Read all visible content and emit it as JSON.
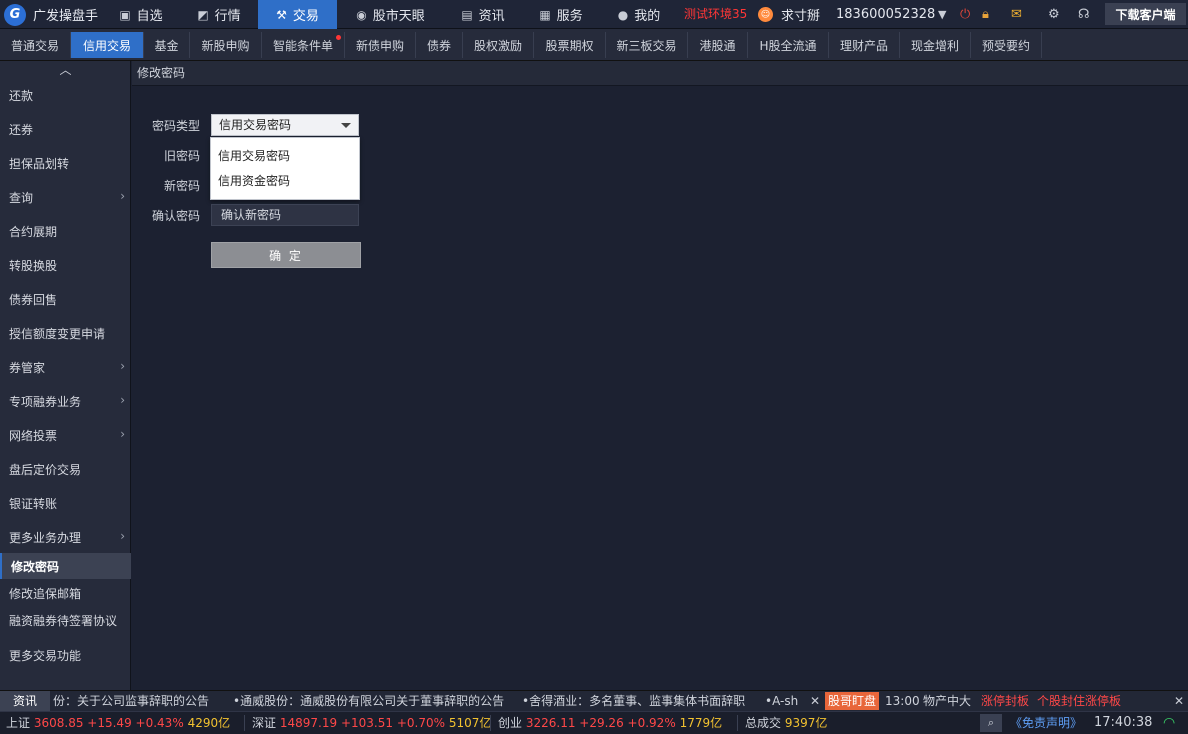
{
  "app": {
    "name": "广发操盘手",
    "logo_letter": "G"
  },
  "topnav": [
    {
      "label": "自选",
      "icon": "star-box-icon"
    },
    {
      "label": "行情",
      "icon": "chart-icon"
    },
    {
      "label": "交易",
      "icon": "gavel-icon",
      "active": true
    },
    {
      "label": "股市天眼",
      "icon": "eye-icon"
    },
    {
      "label": "资讯",
      "icon": "news-icon"
    },
    {
      "label": "服务",
      "icon": "briefcase-icon"
    },
    {
      "label": "我的",
      "icon": "user-icon"
    }
  ],
  "env_label": "测试环境35",
  "user": {
    "name": "求寸掰",
    "phone": "183600052328"
  },
  "download_label": "下载客户端",
  "subtabs": [
    "普通交易",
    "信用交易",
    "基金",
    "新股申购",
    "智能条件单",
    "新债申购",
    "债券",
    "股权激励",
    "股票期权",
    "新三板交易",
    "港股通",
    "H股全流通",
    "理财产品",
    "现金增利",
    "预受要约"
  ],
  "sidebar": {
    "items": [
      "还款",
      "还券",
      "担保品划转",
      "查询",
      "合约展期",
      "转股换股",
      "债券回售",
      "授信额度变更申请",
      "券管家",
      "专项融券业务",
      "网络投票",
      "盘后定价交易",
      "银证转账",
      "更多业务办理",
      "修改密码",
      "修改追保邮箱",
      "融资融券待签署协议",
      "更多交易功能"
    ]
  },
  "main": {
    "breadcrumb": "修改密码",
    "form": {
      "type_label": "密码类型",
      "type_value": "信用交易密码",
      "options": [
        "信用交易密码",
        "信用资金密码"
      ],
      "old_label": "旧密码",
      "new_label": "新密码",
      "confirm_label": "确认密码",
      "confirm_placeholder": "确认新密码",
      "submit": "确 定"
    }
  },
  "ticker": {
    "tab": "资讯",
    "news1": "份：关于公司监事辞职的公告",
    "news2": "•通威股份：通威股份有限公司关于董事辞职的公告",
    "news3": "•舍得酒业：多名董事、监事集体书面辞职",
    "news4": "•A-sh",
    "hot_label": "股哥盯盘",
    "time": "13:00",
    "item1": "物产中大",
    "item2": "涨停封板",
    "item3": "个股封住涨停板"
  },
  "status": {
    "sh": {
      "label": "上证",
      "price": "3608.85",
      "chg": "+15.49",
      "pct": "+0.43%",
      "vol": "4290亿"
    },
    "sz": {
      "label": "深证",
      "price": "14897.19",
      "chg": "+103.51",
      "pct": "+0.70%",
      "vol": "5107亿"
    },
    "cy": {
      "label": "创业",
      "price": "3226.11",
      "chg": "+29.26",
      "pct": "+0.92%",
      "vol": "1779亿"
    },
    "total_label": "总成交",
    "total_value": "9397亿",
    "disclaimer": "《免责声明》",
    "clock": "17:40:38"
  },
  "colors": {
    "accent": "#2f6fc8",
    "up": "#ff4848",
    "volume": "#f2c230",
    "hot": "#e8663a"
  }
}
